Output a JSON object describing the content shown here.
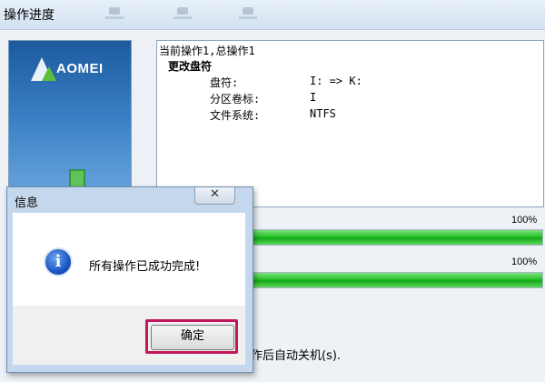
{
  "window": {
    "title": "操作进度"
  },
  "sidebar": {
    "logo_text": "AOMEI"
  },
  "operations": {
    "header": "当前操作1,总操作1",
    "op_title": "更改盘符",
    "fields": [
      {
        "label": "盘符:",
        "value": "I: => K:"
      },
      {
        "label": "分区卷标:",
        "value": "I"
      },
      {
        "label": "文件系统:",
        "value": "NTFS"
      }
    ]
  },
  "progress": [
    {
      "label": "100%",
      "value": 1.0
    },
    {
      "label": "100%",
      "value": 1.0
    }
  ],
  "shutdown_text": "作后自动关机(s).",
  "dialog": {
    "title": "信息",
    "close_glyph": "✕",
    "icon_glyph": "i",
    "message": "所有操作已成功完成!",
    "ok_label": "确定"
  }
}
